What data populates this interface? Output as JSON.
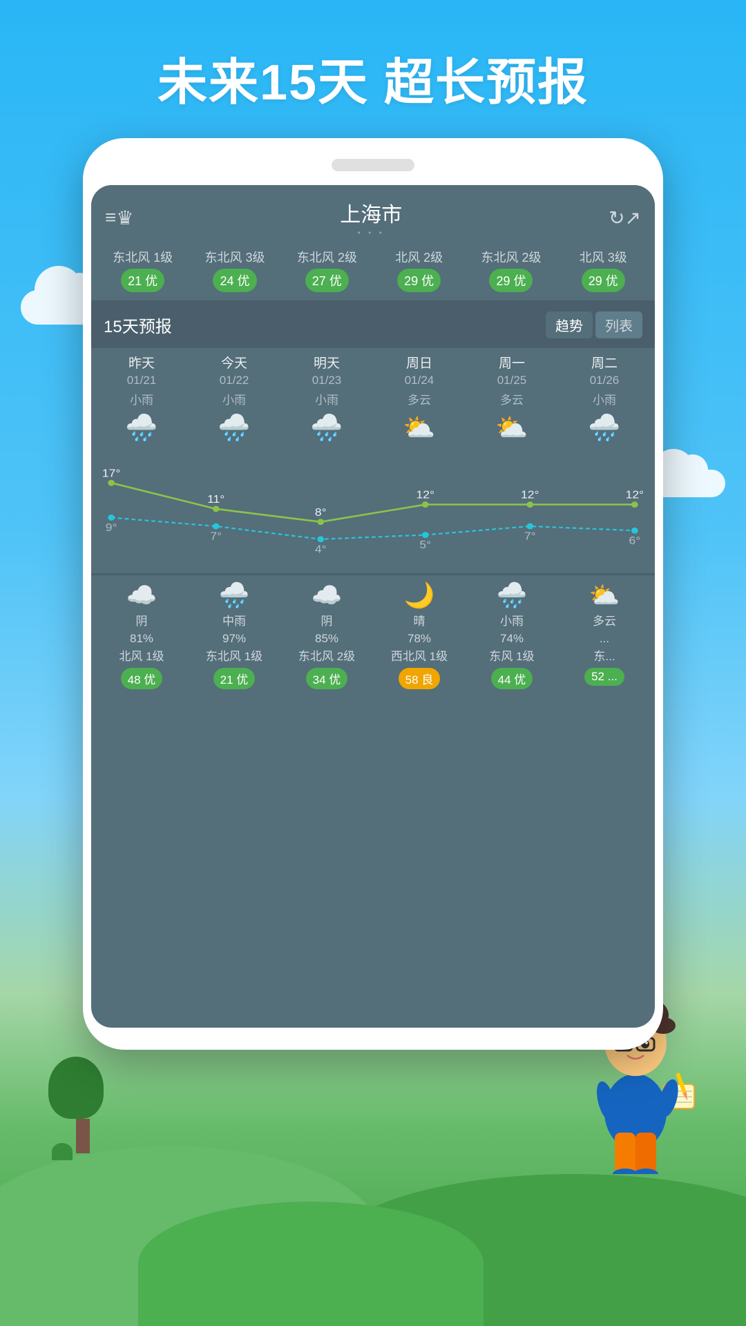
{
  "headline": "未来15天  超长预报",
  "header": {
    "menu_icon": "≡",
    "crown_icon": "♛",
    "city": "上海市",
    "dots": "• • •",
    "refresh_icon": "↻",
    "share_icon": "↗"
  },
  "aqi_row": [
    {
      "wind": "东北风\n1级",
      "badge": "21 优",
      "yellow": false
    },
    {
      "wind": "东北风\n3级",
      "badge": "24 优",
      "yellow": false
    },
    {
      "wind": "东北风\n2级",
      "badge": "27 优",
      "yellow": false
    },
    {
      "wind": "北风\n2级",
      "badge": "29 优",
      "yellow": false
    },
    {
      "wind": "东北风\n2级",
      "badge": "29 优",
      "yellow": false
    },
    {
      "wind": "北风\n3级",
      "badge": "29 优",
      "yellow": false
    }
  ],
  "forecast_title": "15天预报",
  "forecast_tabs": [
    "趋势",
    "列表"
  ],
  "days": [
    {
      "label": "昨天",
      "date": "01/21",
      "weather": "小雨",
      "icon": "🌧️",
      "high": 17,
      "low": 9
    },
    {
      "label": "今天",
      "date": "01/22",
      "weather": "小雨",
      "icon": "🌧️",
      "high": 11,
      "low": 7
    },
    {
      "label": "明天",
      "date": "01/23",
      "weather": "小雨",
      "icon": "🌧️",
      "high": 8,
      "low": 4
    },
    {
      "label": "周日",
      "date": "01/24",
      "weather": "多云",
      "icon": "⛅",
      "high": 12,
      "low": 5
    },
    {
      "label": "周一",
      "date": "01/25",
      "weather": "多云",
      "icon": "⛅",
      "high": 12,
      "low": 7
    },
    {
      "label": "周二",
      "date": "01/26",
      "weather": "小雨",
      "icon": "🌧️",
      "high": 12,
      "low": 6
    }
  ],
  "bottom_days": [
    {
      "icon": "☁️",
      "condition": "阴",
      "humidity": "81%",
      "wind": "北风\n1级",
      "badge": "48 优",
      "yellow": false
    },
    {
      "icon": "🌧️",
      "condition": "中雨",
      "humidity": "97%",
      "wind": "东北风\n1级",
      "badge": "21 优",
      "yellow": false
    },
    {
      "icon": "☁️",
      "condition": "阴",
      "humidity": "85%",
      "wind": "东北风\n2级",
      "badge": "34 优",
      "yellow": false
    },
    {
      "icon": "🌙",
      "condition": "晴",
      "humidity": "78%",
      "wind": "西北风\n1级",
      "badge": "58 良",
      "yellow": true
    },
    {
      "icon": "🌧️",
      "condition": "小雨",
      "humidity": "74%",
      "wind": "东风\n1级",
      "badge": "44 优",
      "yellow": false
    },
    {
      "icon": "⛅",
      "condition": "多云",
      "humidity": "...",
      "wind": "东...",
      "badge": "52 ...",
      "yellow": false
    }
  ],
  "colors": {
    "bg_sky": "#29b6f6",
    "app_bg": "#546e7a",
    "green_badge": "#4caf50",
    "yellow_badge": "#f0a500",
    "line_green": "#8bc34a",
    "line_teal": "#26c6da"
  }
}
